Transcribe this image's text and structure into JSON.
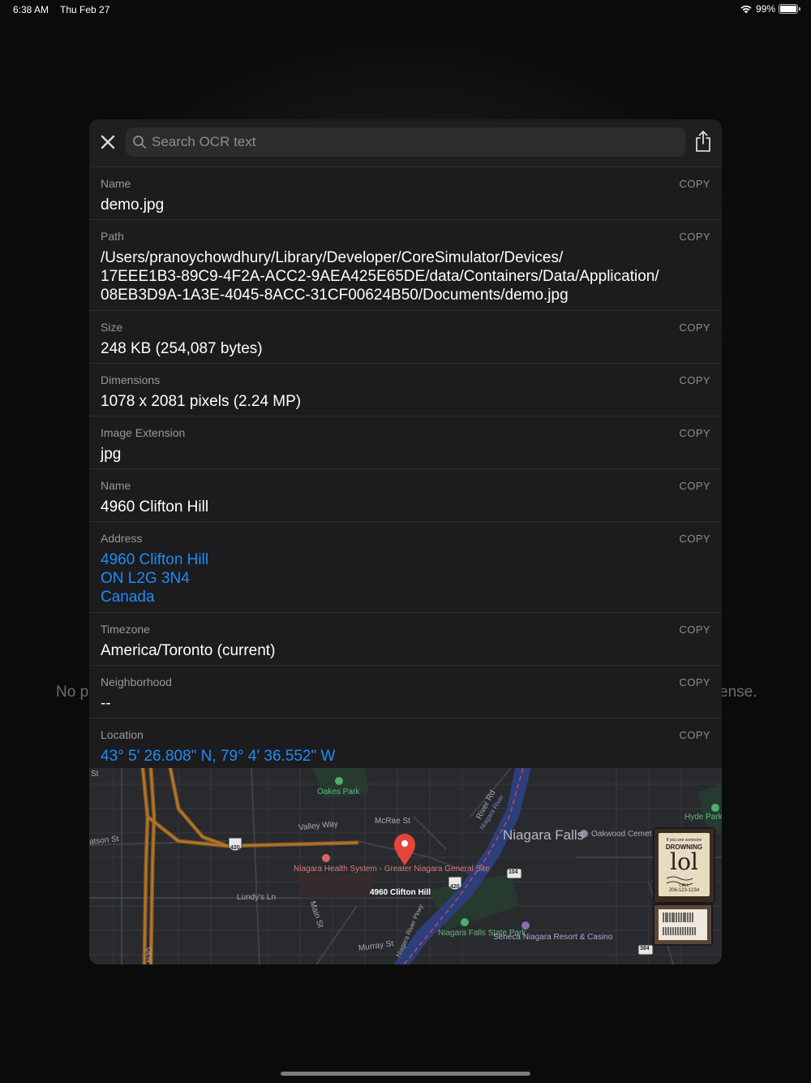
{
  "status_bar": {
    "time": "6:38 AM",
    "date": "Thu Feb 27",
    "battery": "99%",
    "battery_level": 0.99
  },
  "background": {
    "left_fragment": "No p",
    "right_fragment": "ense."
  },
  "toolbar": {
    "close_icon": "close-icon",
    "search_placeholder": "Search OCR text",
    "share_icon": "share-icon"
  },
  "copy_label": "COPY",
  "rows": [
    {
      "label": "Name",
      "lines": [
        "demo.jpg"
      ],
      "is_link": false
    },
    {
      "label": "Path",
      "lines": [
        "/Users/pranoychowdhury/Library/Developer/CoreSimulator/Devices/",
        "17EEE1B3-89C9-4F2A-ACC2-9AEA425E65DE/data/Containers/Data/Application/",
        "08EB3D9A-1A3E-4045-8ACC-31CF00624B50/Documents/demo.jpg"
      ],
      "is_link": false
    },
    {
      "label": "Size",
      "lines": [
        "248 KB (254,087 bytes)"
      ],
      "is_link": false
    },
    {
      "label": "Dimensions",
      "lines": [
        "1078 x 2081 pixels (2.24 MP)"
      ],
      "is_link": false
    },
    {
      "label": "Image Extension",
      "lines": [
        "jpg"
      ],
      "is_link": false
    },
    {
      "label": "Name",
      "lines": [
        "4960 Clifton Hill"
      ],
      "is_link": false
    },
    {
      "label": "Address",
      "lines": [
        "4960 Clifton Hill",
        "ON L2G 3N4",
        "Canada"
      ],
      "is_link": true
    },
    {
      "label": "Timezone",
      "lines": [
        "America/Toronto (current)"
      ],
      "is_link": false
    },
    {
      "label": "Neighborhood",
      "lines": [
        "--"
      ],
      "is_link": false
    },
    {
      "label": "Location",
      "lines": [
        "43° 5' 26.808\" N, 79° 4' 36.552\" W"
      ],
      "is_link": true
    }
  ],
  "map": {
    "pin_label": "4960 Clifton Hill",
    "labels": {
      "st": "St",
      "oakes_park": "Oakes Park",
      "valley_way": "Valley Way",
      "mcrae_st": "McRae St",
      "river_rd": "River Rd",
      "niagara_river": "Niagara River",
      "niagara_falls": "Niagara Falls",
      "oakwood": "Oakwood Cemet",
      "hyde_park": "Hyde Park League Z",
      "watson_st": "atson St",
      "hospital": "Niagara Health System - Greater Niagara General Site",
      "lundys_ln": "Lundy's Ln",
      "main_st": "Main St",
      "river_pkwy": "Niagara River Pkwy",
      "state_park": "Niagara Falls State Park",
      "casino": "Seneca Niagara Resort & Casino",
      "murray_st": "Murray St",
      "qew": "QEW",
      "hwy_420": "420",
      "hwy_104": "104",
      "hwy_384": "384"
    },
    "thumbnail": {
      "small": "If you see someone",
      "heading": "DROWNING",
      "big": "lol",
      "call": "CALL",
      "phone": "206-123-1234"
    }
  }
}
